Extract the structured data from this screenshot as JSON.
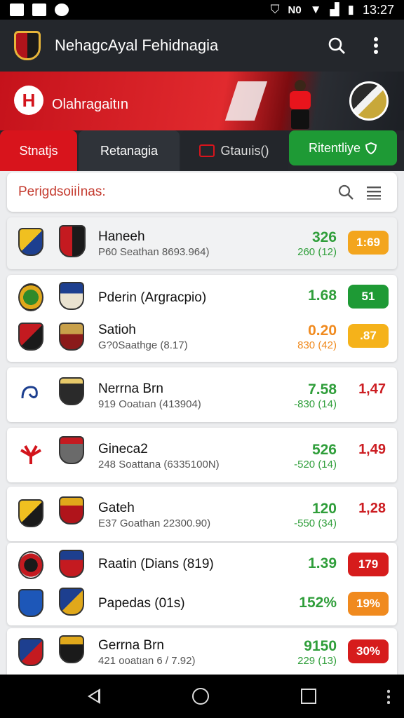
{
  "status_bar": {
    "network_label": "N0",
    "signal_label": "",
    "time": "13:27"
  },
  "app_bar": {
    "title": "NehagcAyal Fehidnagia"
  },
  "hero": {
    "title": "Olahragaitın"
  },
  "tabs": [
    {
      "label": "Stnatjs",
      "active": true
    },
    {
      "label": "Retanagia",
      "active": false
    },
    {
      "label": "Gtauıis()",
      "active": false
    },
    {
      "label": "Ritentliye",
      "active": false
    }
  ],
  "search": {
    "title": "Perigdsoiiİnas:"
  },
  "matches": [
    {
      "name": "Haneeh",
      "sub": "P60 Seathan 8693.964)",
      "odds": "326",
      "odds_sub": "260 (12)",
      "pill": "1:69",
      "pill_color": "#f3a51e",
      "odds_color": "#2f9e3a",
      "sub_color": "#2f9e3a"
    },
    {
      "name": "Pderin (Argracpio)",
      "sub": "",
      "odds": "1.68",
      "odds_sub": "",
      "pill": "51",
      "pill_color": "#1e9a35",
      "odds_color": "#2f9e3a",
      "sub_color": "#2f9e3a"
    },
    {
      "name": "Satioh",
      "sub": "G?0Saathge (8.17)",
      "odds": "0.20",
      "odds_sub": "830 (42)",
      "pill": ".87",
      "pill_color": "#f5b21a",
      "odds_color": "#f08a1e",
      "sub_color": "#f08a1e"
    },
    {
      "name": "Nerrna Brn",
      "sub": "919 Ooatıan (413904)",
      "odds": "7.58",
      "odds_sub": "-830 (14)",
      "plain": "1,47",
      "odds_color": "#2f9e3a",
      "sub_color": "#2f9e3a"
    },
    {
      "name": "Gineca2",
      "sub": "248 Soattana (6335100N)",
      "odds": "526",
      "odds_sub": "-520 (14)",
      "plain": "1,49",
      "odds_color": "#2f9e3a",
      "sub_color": "#2f9e3a"
    },
    {
      "name": "Gateh",
      "sub": "E37 Goathan 22300.90)",
      "odds": "120",
      "odds_sub": "-550 (34)",
      "plain": "1,28",
      "odds_color": "#2f9e3a",
      "sub_color": "#2f9e3a"
    },
    {
      "name": "Raatin (Dians (819)",
      "sub": "",
      "odds": "1.39",
      "odds_sub": "",
      "pill": "179",
      "pill_color": "#d61c1c",
      "odds_color": "#2f9e3a",
      "sub_color": "#2f9e3a"
    },
    {
      "name": "Papedas (01s)",
      "sub": "",
      "odds": "152%",
      "odds_sub": "",
      "pill": "19%",
      "pill_color": "#f08a1e",
      "odds_color": "#2f9e3a",
      "sub_color": "#2f9e3a"
    },
    {
      "name": "Gerrna Brn",
      "sub": "421 ooatıan 6 / 7.92)",
      "odds": "9150",
      "odds_sub": "229 (13)",
      "pill": "30%",
      "pill_color": "#d61c1c",
      "odds_color": "#2f9e3a",
      "sub_color": "#2f9e3a"
    }
  ],
  "colors": {
    "brand_red": "#d8141c",
    "bar_dark": "#24272c",
    "green": "#1e9a35"
  }
}
